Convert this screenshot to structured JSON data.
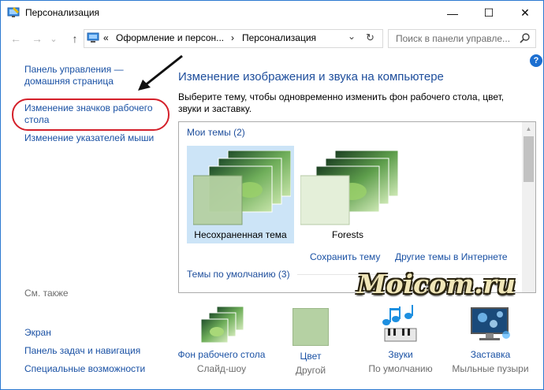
{
  "window": {
    "title": "Персонализация",
    "minimize": "—",
    "maximize": "☐",
    "close": "✕"
  },
  "nav": {
    "back": "←",
    "forward": "→",
    "dropdown": "⌄",
    "up": "↑"
  },
  "address": {
    "overflow": "«",
    "crumb1": "Оформление и персон...",
    "sep": "›",
    "crumb2": "Персонализация",
    "dropdown": "⌄",
    "refresh": "↻"
  },
  "search": {
    "placeholder": "Поиск в панели управле..."
  },
  "help": "?",
  "sidebar": {
    "home_line1": "Панель управления —",
    "home_line2": "домашняя страница",
    "icons_line1": "Изменение значков рабочего",
    "icons_line2": "стола",
    "pointers": "Изменение указателей мыши",
    "see_also": "См. также",
    "screen": "Экран",
    "taskbar": "Панель задач и навигация",
    "accessibility": "Специальные возможности"
  },
  "main": {
    "heading": "Изменение изображения и звука на компьютере",
    "description": "Выберите тему, чтобы одновременно изменить фон рабочего стола, цвет, звуки и заставку.",
    "my_themes": "Мои темы (2)",
    "themes": [
      {
        "name": "Несохраненная тема"
      },
      {
        "name": "Forests"
      }
    ],
    "save_theme": "Сохранить тему",
    "more_themes": "Другие темы в Интернете",
    "default_themes": "Темы по умолчанию (3)"
  },
  "watermark": "Moicom.ru",
  "bottom": [
    {
      "title": "Фон рабочего стола",
      "sub": "Слайд-шоу",
      "icon": "wallpaper-icon"
    },
    {
      "title": "Цвет",
      "sub": "Другой",
      "icon": "color-icon"
    },
    {
      "title": "Звуки",
      "sub": "По умолчанию",
      "icon": "sounds-icon"
    },
    {
      "title": "Заставка",
      "sub": "Мыльные пузыри",
      "icon": "screensaver-icon"
    }
  ],
  "colors": {
    "link": "#1a51a4",
    "heading": "#1e4e9c",
    "selection": "#cce4f7",
    "highlight_circle": "#d4202a",
    "theme_color": "#b5d1a3"
  }
}
